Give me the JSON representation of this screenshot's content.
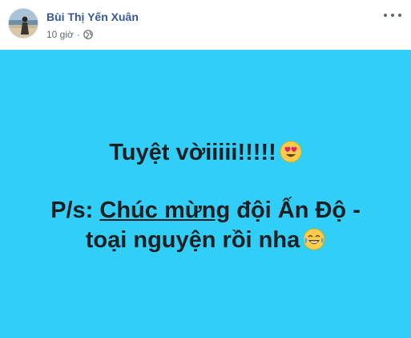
{
  "post": {
    "author": "Bùi Thị Yến Xuân",
    "time": "10 giờ",
    "separator": "·",
    "privacy_icon": "globe-icon",
    "menu_icon": "more-options-icon",
    "background_color": "#31cff8",
    "text": {
      "line1": "Tuyệt vờiiiii!!!!!",
      "line1_emoji": "heart-eyes-emoji",
      "line2_prefix": "P/s: ",
      "line2_underlined": "Chúc mừng",
      "line2_suffix": " đội Ấn Độ -",
      "line3": "toại nguyện rồi nha",
      "line3_emoji": "tears-of-joy-emoji"
    }
  }
}
